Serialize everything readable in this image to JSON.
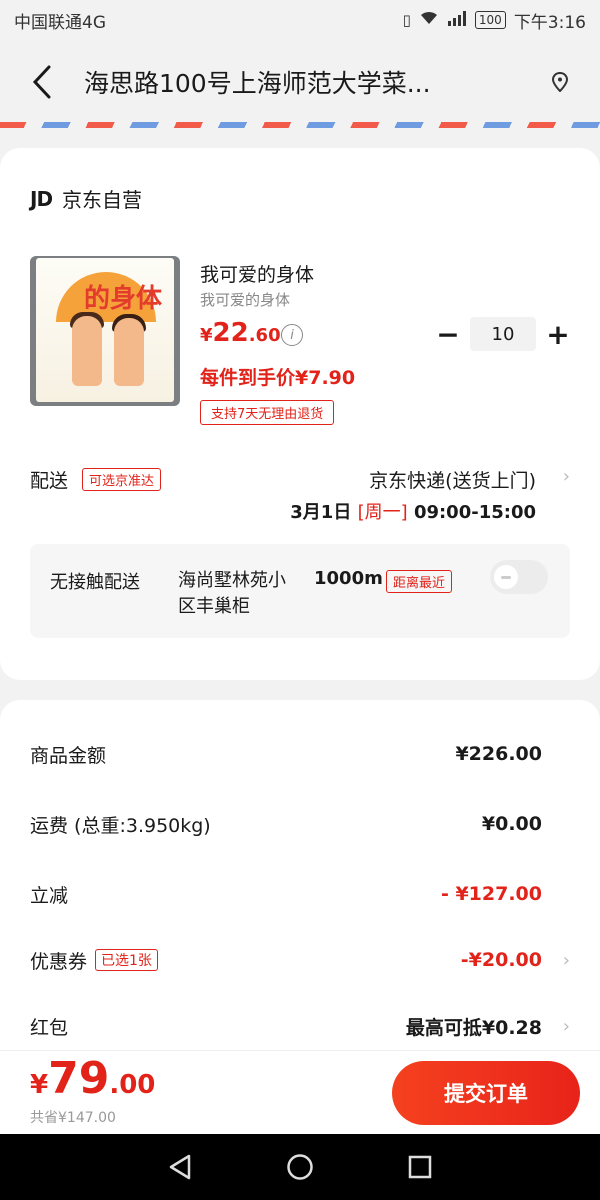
{
  "status_bar": {
    "carrier": "中国联通4G",
    "time": "下午3:16",
    "battery": "100",
    "signal": "4G"
  },
  "header": {
    "address": "海思路100号上海师范大学菜..."
  },
  "shop": {
    "logo": "JD",
    "name": "京东自营"
  },
  "product": {
    "name": "我可爱的身体",
    "subtitle": "我可爱的身体",
    "cover_text": "的身体",
    "price_currency": "¥",
    "price_int": "22",
    "price_dec": ".60",
    "unit_price": "每件到手价¥7.90",
    "return_tag": "支持7天无理由退货",
    "quantity": "10"
  },
  "delivery": {
    "label": "配送",
    "tag": "可选京准达",
    "method": "京东快递(送货上门)",
    "date": "3月1日",
    "weekday": "[周一]",
    "slot": "09:00-15:00"
  },
  "contactless": {
    "label": "无接触配送",
    "location": "海尚墅林苑小区丰巢柜",
    "distance": "1000m",
    "tag": "距离最近",
    "enabled": false
  },
  "summary": {
    "goods_label": "商品金额",
    "goods_value": "¥226.00",
    "shipping_label": "运费 (总重:3.950kg)",
    "shipping_value": "¥0.00",
    "discount_label": "立减",
    "discount_value": "- ¥127.00",
    "coupon_label": "优惠券",
    "coupon_tag": "已选1张",
    "coupon_value": "-¥20.00",
    "redpacket_label": "红包",
    "redpacket_value": "最高可抵¥0.28"
  },
  "footer": {
    "total_currency": "¥",
    "total_int": "79",
    "total_dec": ".00",
    "saved": "共省¥147.00",
    "submit_label": "提交订单"
  },
  "colors": {
    "accent": "#e2231a",
    "airmail_red": "#f25b4a",
    "airmail_blue": "#6f9be0"
  }
}
